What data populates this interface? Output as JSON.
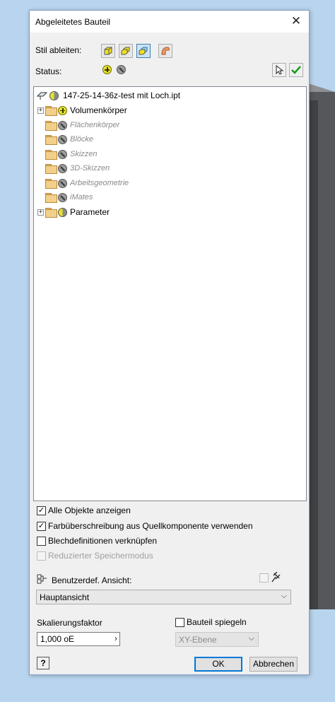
{
  "dialog": {
    "title": "Abgeleitetes Bauteil",
    "close_glyph": "✕"
  },
  "stil": {
    "label": "Stil ableiten:"
  },
  "status": {
    "label": "Status:"
  },
  "tree": {
    "root": {
      "label": "147-25-14-36z-test mit Loch.ipt"
    },
    "items": [
      {
        "label": "Volumenkörper",
        "state": "include",
        "expandable": true
      },
      {
        "label": "Flächenkörper",
        "state": "exclude",
        "expandable": false
      },
      {
        "label": "Blöcke",
        "state": "exclude",
        "expandable": false
      },
      {
        "label": "Skizzen",
        "state": "exclude",
        "expandable": false
      },
      {
        "label": "3D-Skizzen",
        "state": "exclude",
        "expandable": false
      },
      {
        "label": "Arbeitsgeometrie",
        "state": "exclude",
        "expandable": false
      },
      {
        "label": "iMates",
        "state": "exclude",
        "expandable": false
      },
      {
        "label": "Parameter",
        "state": "partial",
        "expandable": true
      }
    ]
  },
  "options": {
    "alle_objekte": {
      "label": "Alle Objekte anzeigen",
      "checked": true
    },
    "farbueberschreibung": {
      "label": "Farbüberschreibung aus Quellkomponente verwenden",
      "checked": true
    },
    "blechdefinitionen": {
      "label": "Blechdefinitionen verknüpfen",
      "checked": false
    },
    "reduzierter": {
      "label": "Reduzierter Speichermodus",
      "checked": false,
      "disabled": true
    }
  },
  "view": {
    "label": "Benutzerdef. Ansicht:",
    "selected": "Hauptansicht"
  },
  "scale": {
    "label": "Skalierungsfaktor",
    "value": "1,000 oE"
  },
  "mirror": {
    "label": "Bauteil spiegeln",
    "checked": false,
    "plane": "XY-Ebene"
  },
  "buttons": {
    "help": "?",
    "ok": "OK",
    "cancel": "Abbrechen"
  }
}
